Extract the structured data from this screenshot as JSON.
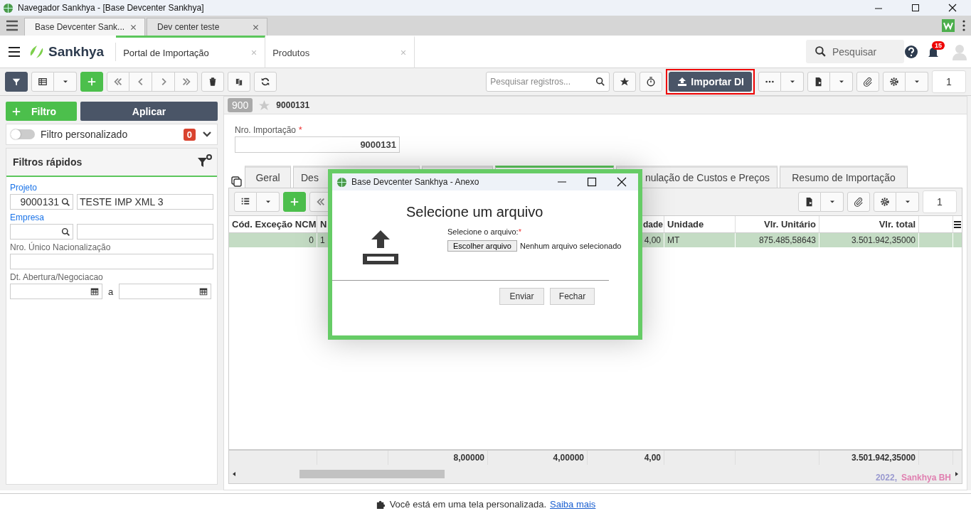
{
  "window": {
    "title": "Navegador Sankhya - [Base Devcenter Sankhya]"
  },
  "browser_tabs": [
    {
      "label": "Base Devcenter Sank...",
      "selected": true
    },
    {
      "label": "Dev center teste",
      "selected": false
    }
  ],
  "app_header": {
    "logo": "Sankhya",
    "tabs": [
      {
        "label": "Portal de Importação",
        "selected": true
      },
      {
        "label": "Produtos",
        "selected": false
      }
    ],
    "search": {
      "placeholder": "Pesquisar"
    },
    "notifications": "15"
  },
  "toolbar": {
    "filter_active": true,
    "search": {
      "placeholder": "Pesquisar registros..."
    },
    "import_button": "Importar DI",
    "page": "1"
  },
  "filter_panel": {
    "add_button": "Filtro",
    "apply_button": "Aplicar",
    "custom_filter": {
      "label": "Filtro personalizado",
      "on": false,
      "count": "0"
    },
    "quick_filters": {
      "title": "Filtros rápidos",
      "fields": [
        {
          "kind": "lookup",
          "label": "Projeto",
          "code": "9000131",
          "description": "TESTE IMP XML 3"
        },
        {
          "kind": "lookup",
          "label": "Empresa"
        },
        {
          "kind": "text",
          "label": "Nro. Único Nacionalização"
        },
        {
          "kind": "date_range",
          "label": "Dt. Abertura/Negociacao",
          "separator": "a"
        }
      ]
    }
  },
  "record": {
    "badge": "900",
    "starred": false,
    "id": "9000131",
    "field": {
      "label": "Nro. Importação",
      "required_mark": "*",
      "value": "9000131"
    }
  },
  "detail_tabs": [
    {
      "label": "Geral",
      "selected": false
    },
    {
      "label": "Des",
      "selected": false
    },
    {
      "selected": false
    },
    {
      "selected": true
    },
    {
      "label": "nulação de Custos e Preços",
      "selected": false
    },
    {
      "label": "Resumo de Importação",
      "selected": false
    }
  ],
  "grid": {
    "page": "1",
    "columns": [
      "Cód. Exceção NCM",
      "N",
      null,
      null,
      "dade",
      "Unidade",
      "Vlr. Unitário",
      "Vlr. total",
      null
    ],
    "rows": [
      {
        "selected": true,
        "cells": [
          "0",
          "1",
          null,
          null,
          "4,00",
          "MT",
          "875.485,58643",
          "3.501.942,35000",
          null
        ]
      }
    ],
    "totals": {
      "column_3": "8,00000",
      "column_4": "4,00000",
      "column_5": "4,00",
      "column_8": "3.501.942,35000"
    },
    "footer_year": "2022,",
    "footer_company": "Sankhya BH"
  },
  "dialog": {
    "title": "Base Devcenter Sankhya - Anexo",
    "heading": "Selecione um arquivo",
    "file_label": "Selecione o arquivo:",
    "required_mark": "*",
    "choose_button": "Escolher arquivo",
    "no_file": "Nenhum arquivo selecionado",
    "buttons": [
      "Enviar",
      "Fechar"
    ]
  },
  "footer": {
    "text": "Você está em uma tela personalizada.",
    "link": "Saiba mais"
  }
}
